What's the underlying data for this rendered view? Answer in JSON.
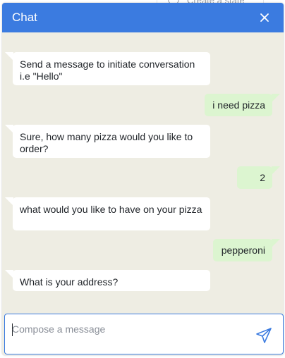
{
  "background": {
    "partial_text": "Create a state"
  },
  "chat": {
    "title": "Chat",
    "close_icon": "close-icon",
    "colors": {
      "header": "#3b7be0",
      "panel": "#eeede3",
      "bot_bubble": "#ffffff",
      "user_bubble": "#dcf5d0"
    },
    "messages": [
      {
        "sender": "bot",
        "text": "Send a message to initiate conversation i.e \"Hello\""
      },
      {
        "sender": "user",
        "text": "i need pizza"
      },
      {
        "sender": "bot",
        "text": "Sure, how many pizza would you like to order?"
      },
      {
        "sender": "user",
        "text": "2"
      },
      {
        "sender": "bot",
        "text": "what would you like to have on your pizza"
      },
      {
        "sender": "user",
        "text": "pepperoni"
      },
      {
        "sender": "bot",
        "text": "What is your address?"
      }
    ]
  },
  "compose": {
    "placeholder": "Compose a message",
    "value": "",
    "send_icon": "send-icon"
  }
}
